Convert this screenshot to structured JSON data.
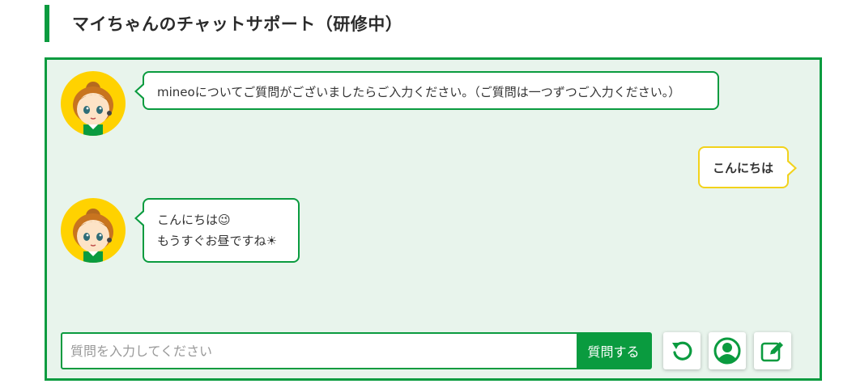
{
  "header": {
    "title": "マイちゃんのチャットサポート（研修中）"
  },
  "messages": [
    {
      "sender": "bot",
      "lines": [
        "mineoについてご質問がございましたらご入力ください。（ご質問は一つずつご入力ください。）"
      ]
    },
    {
      "sender": "user",
      "lines": [
        "こんにちは"
      ]
    },
    {
      "sender": "bot",
      "lines": [
        "こんにちは😉",
        "もうすぐお昼ですね☀"
      ]
    }
  ],
  "input": {
    "placeholder": "質問を入力してください",
    "value": ""
  },
  "buttons": {
    "send_label": "質問する",
    "reset_icon": "refresh-icon",
    "operator_icon": "user-circle-icon",
    "survey_icon": "edit-icon"
  },
  "colors": {
    "accent": "#0a9b3f",
    "chat_bg": "#e8f4ec",
    "user_bubble_border": "#f2d21b",
    "avatar_bg": "#ffd200"
  }
}
